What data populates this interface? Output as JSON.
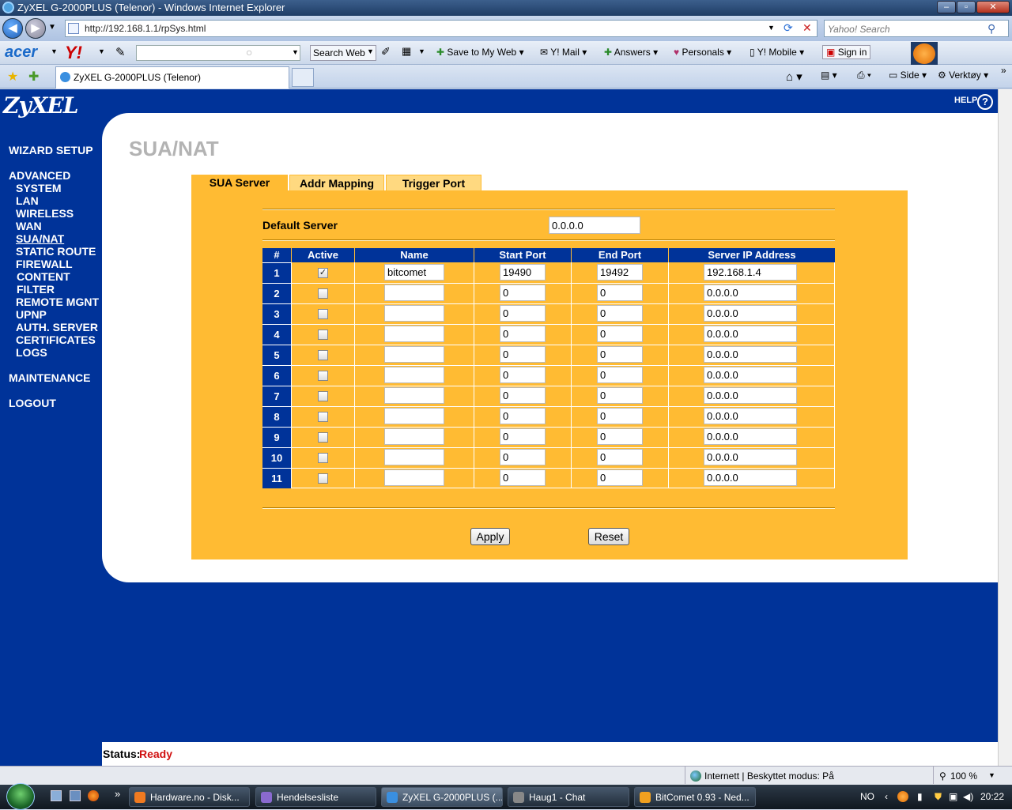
{
  "window": {
    "title": "ZyXEL G-2000PLUS (Telenor) - Windows Internet Explorer",
    "url": "http://192.168.1.1/rpSys.html",
    "search_placeholder": "Yahoo! Search",
    "tab_title": "ZyXEL G-2000PLUS (Telenor)"
  },
  "toolbar": {
    "acer": "acer",
    "yahoo": "Y!",
    "search_web": "Search Web",
    "save_to_my_web": "Save to My Web",
    "ymail": "Y! Mail",
    "answers": "Answers",
    "personals": "Personals",
    "ymobile": "Y! Mobile",
    "sign_in": "Sign in"
  },
  "commandbar": {
    "side": "Side",
    "verktoy": "Verktøy"
  },
  "page": {
    "logo": "ZyXEL",
    "help": "HELP",
    "title": "SUA/NAT",
    "menu": {
      "wizard": "WIZARD SETUP",
      "advanced": "ADVANCED",
      "system": "SYSTEM",
      "lan": "LAN",
      "wireless": "WIRELESS",
      "wan": "WAN",
      "suanat": "SUA/NAT",
      "static_route": "STATIC ROUTE",
      "firewall": "FIREWALL",
      "content": "CONTENT",
      "filter": "FILTER",
      "remote_mgnt": "REMOTE MGNT",
      "upnp": "UPNP",
      "auth_server": "AUTH. SERVER",
      "certificates": "CERTIFICATES",
      "logs": "LOGS",
      "maintenance": "MAINTENANCE",
      "logout": "LOGOUT"
    },
    "tabs": {
      "sua_server": "SUA Server",
      "addr_mapping": "Addr Mapping",
      "trigger_port": "Trigger Port"
    },
    "default_server_label": "Default Server",
    "default_server_value": "0.0.0.0",
    "table": {
      "headers": [
        "#",
        "Active",
        "Name",
        "Start Port",
        "End Port",
        "Server IP Address"
      ],
      "rows": [
        {
          "num": "1",
          "active": true,
          "name": "bitcomet",
          "start": "19490",
          "end": "19492",
          "ip": "192.168.1.4"
        },
        {
          "num": "2",
          "active": false,
          "name": "",
          "start": "0",
          "end": "0",
          "ip": "0.0.0.0"
        },
        {
          "num": "3",
          "active": false,
          "name": "",
          "start": "0",
          "end": "0",
          "ip": "0.0.0.0"
        },
        {
          "num": "4",
          "active": false,
          "name": "",
          "start": "0",
          "end": "0",
          "ip": "0.0.0.0"
        },
        {
          "num": "5",
          "active": false,
          "name": "",
          "start": "0",
          "end": "0",
          "ip": "0.0.0.0"
        },
        {
          "num": "6",
          "active": false,
          "name": "",
          "start": "0",
          "end": "0",
          "ip": "0.0.0.0"
        },
        {
          "num": "7",
          "active": false,
          "name": "",
          "start": "0",
          "end": "0",
          "ip": "0.0.0.0"
        },
        {
          "num": "8",
          "active": false,
          "name": "",
          "start": "0",
          "end": "0",
          "ip": "0.0.0.0"
        },
        {
          "num": "9",
          "active": false,
          "name": "",
          "start": "0",
          "end": "0",
          "ip": "0.0.0.0"
        },
        {
          "num": "10",
          "active": false,
          "name": "",
          "start": "0",
          "end": "0",
          "ip": "0.0.0.0"
        },
        {
          "num": "11",
          "active": false,
          "name": "",
          "start": "0",
          "end": "0",
          "ip": "0.0.0.0"
        }
      ]
    },
    "apply": "Apply",
    "reset": "Reset",
    "status_label": "Status:",
    "status_value": "Ready"
  },
  "iestatus": {
    "zone": "Internett | Beskyttet modus: På",
    "zoom": "100 %"
  },
  "taskbar": {
    "tasks": [
      "Hardware.no - Disk...",
      "Hendelsesliste",
      "ZyXEL G-2000PLUS (...",
      "Haug1 - Chat",
      "BitComet 0.93 - Ned..."
    ],
    "lang": "NO",
    "time": "20:22"
  },
  "colors": {
    "page_bg": "#003399",
    "panel": "#ffbb33",
    "status_ready": "#d01010"
  }
}
